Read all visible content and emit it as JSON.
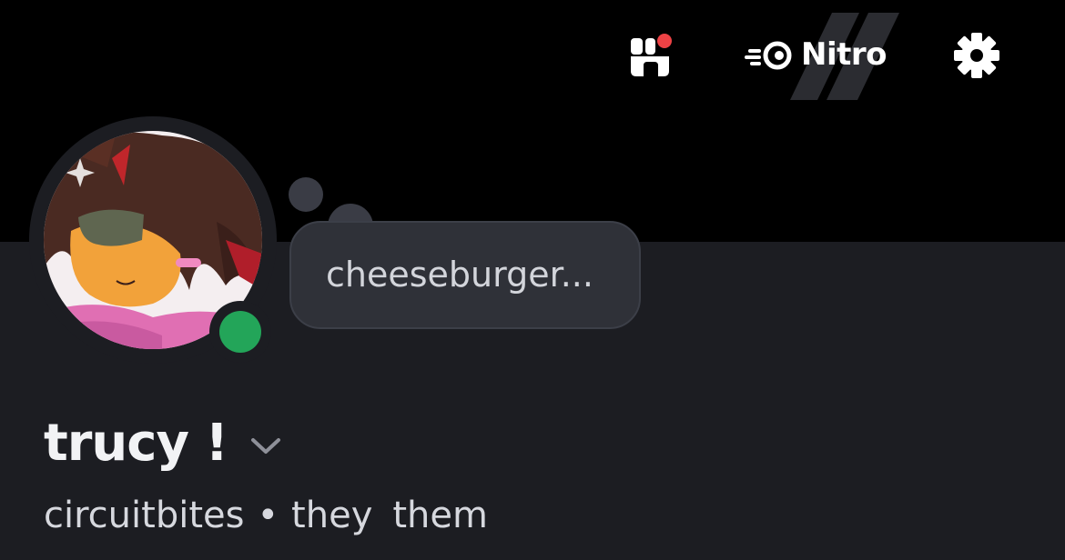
{
  "header": {
    "shop_icon": "shop-icon",
    "shop_notification_color": "#ed4245",
    "nitro": {
      "label": "Nitro",
      "icon": "nitro-icon"
    },
    "settings_icon": "gear-icon"
  },
  "profile": {
    "avatar": "avatar-image",
    "status": {
      "state": "online",
      "color": "#23a559"
    },
    "custom_status": "cheeseburger...",
    "display_name": "trucy !",
    "display_name_chevron_icon": "chevron-down-icon",
    "username": "circuitbites",
    "separator": "•",
    "pronouns": [
      "they",
      "them"
    ]
  },
  "colors": {
    "banner": "#000000",
    "panel": "#1c1d22",
    "bubble": "#2f3138",
    "online": "#23a559",
    "notification": "#ed4245"
  }
}
